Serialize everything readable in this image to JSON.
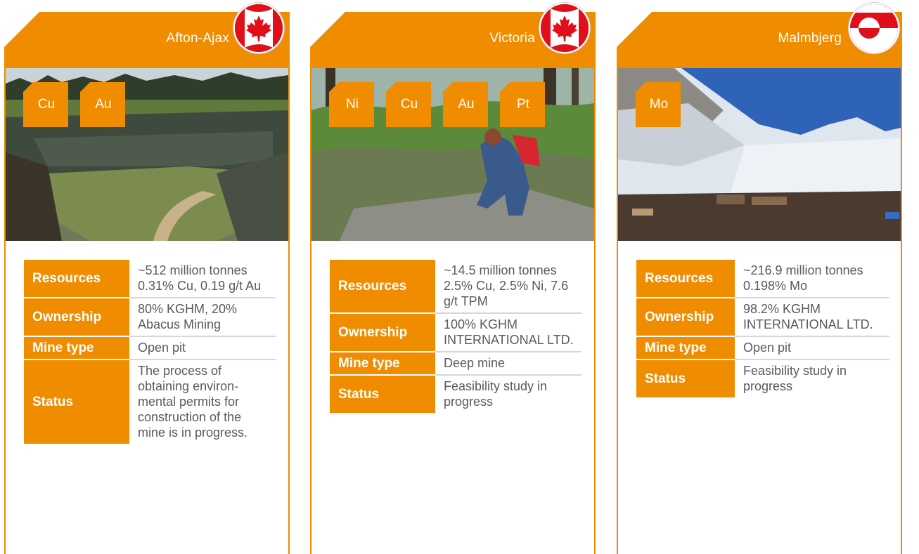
{
  "colors": {
    "accent": "#f08c00",
    "text": "#5a5a5a",
    "flag_red": "#e0101a"
  },
  "cards": [
    {
      "title": "Afton-Ajax",
      "flag_icon": "canada-flag-icon",
      "tags": [
        "Cu",
        "Au"
      ],
      "rows": [
        {
          "label": "Resources",
          "value": "~512 million tonnes 0.31% Cu, 0.19 g/t Au"
        },
        {
          "label": "Ownership",
          "value": "80% KGHM, 20% Abacus Mining"
        },
        {
          "label": "Mine type",
          "value": "Open pit"
        },
        {
          "label": "Status",
          "value": "The process of obtaining environ-mental permits for construction of the mine is in progress."
        }
      ]
    },
    {
      "title": "Victoria",
      "flag_icon": "canada-flag-icon",
      "tags": [
        "Ni",
        "Cu",
        "Au",
        "Pt"
      ],
      "rows": [
        {
          "label": "Resources",
          "value": "~14.5 million tonnes 2.5% Cu, 2.5% Ni, 7.6 g/t TPM"
        },
        {
          "label": "Ownership",
          "value": "100% KGHM INTERNATIONAL LTD."
        },
        {
          "label": "Mine type",
          "value": "Deep mine"
        },
        {
          "label": "Status",
          "value": "Feasibility study in progress"
        }
      ]
    },
    {
      "title": "Malmbjerg",
      "flag_icon": "greenland-flag-icon",
      "tags": [
        "Mo"
      ],
      "rows": [
        {
          "label": "Resources",
          "value": "~216.9 million tonnes 0.198% Mo"
        },
        {
          "label": "Ownership",
          "value": "98.2% KGHM INTERNATIONAL LTD."
        },
        {
          "label": "Mine type",
          "value": "Open pit"
        },
        {
          "label": "Status",
          "value": "Feasibility study in progress"
        }
      ]
    }
  ]
}
